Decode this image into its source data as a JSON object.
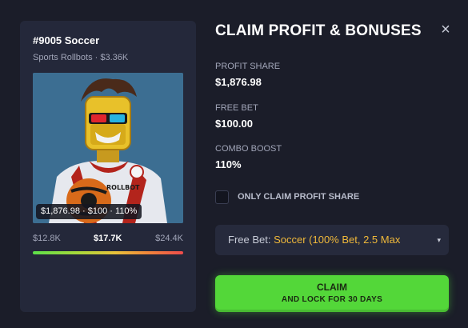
{
  "nft_card": {
    "title": "#9005 Soccer",
    "subtitle": "Sports Rollbots · $3.36K",
    "art_stats": "$1,876.98 · $100 · 110%",
    "art_jersey_text": "ROLLBOT",
    "range": {
      "min": "$12.8K",
      "current": "$17.7K",
      "max": "$24.4K"
    }
  },
  "panel": {
    "title": "CLAIM PROFIT & BONUSES",
    "close_symbol": "×",
    "fields": [
      {
        "label": "PROFIT SHARE",
        "value": "$1,876.98"
      },
      {
        "label": "FREE BET",
        "value": "$100.00"
      },
      {
        "label": "COMBO BOOST",
        "value": "110%"
      }
    ],
    "checkbox_label": "ONLY CLAIM PROFIT SHARE",
    "checkbox_checked": false,
    "free_bet_select": {
      "prefix": "Free Bet:",
      "value": "Soccer (100% Bet, 2.5 Max",
      "caret": "▾"
    },
    "claim_button": {
      "line1": "CLAIM",
      "line2": "AND LOCK FOR 30 DAYS"
    }
  },
  "colors": {
    "background": "#1b1d29",
    "card": "#24283a",
    "accent_green": "#53d739",
    "accent_gold": "#f0b93a",
    "muted_text": "#a1a5b8"
  }
}
